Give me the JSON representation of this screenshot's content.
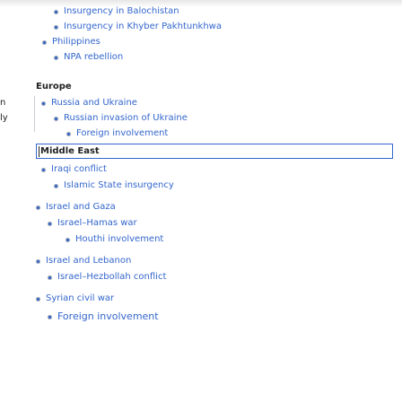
{
  "top_list": [
    {
      "label": "Insurgency in Balochistan"
    },
    {
      "label": "Insurgency in Khyber Pakhtunkhwa"
    },
    {
      "label": "Philippines"
    },
    {
      "label": "NPA rebellion"
    }
  ],
  "europe": {
    "heading": "Europe",
    "items": [
      {
        "label": "Russia and Ukraine"
      },
      {
        "label": "Russian invasion of Ukraine"
      },
      {
        "label": "Foreign involvement"
      }
    ],
    "left_fragments": [
      "n",
      "ly"
    ]
  },
  "middle_east": {
    "search_value": "Middle East",
    "items": [
      {
        "label": "Iraqi conflict"
      },
      {
        "label": "Islamic State insurgency"
      },
      {
        "label": "Israel and Gaza"
      },
      {
        "label": "Israel–Hamas war"
      },
      {
        "label": "Houthi involvement"
      },
      {
        "label": "Israel and Lebanon"
      },
      {
        "label": "Israel–Hezbollah conflict"
      },
      {
        "label": "Syrian civil war"
      },
      {
        "label": "Foreign involvement"
      }
    ]
  },
  "colors": {
    "link": "#3366cc",
    "text": "#202122",
    "border": "#3366cc"
  }
}
